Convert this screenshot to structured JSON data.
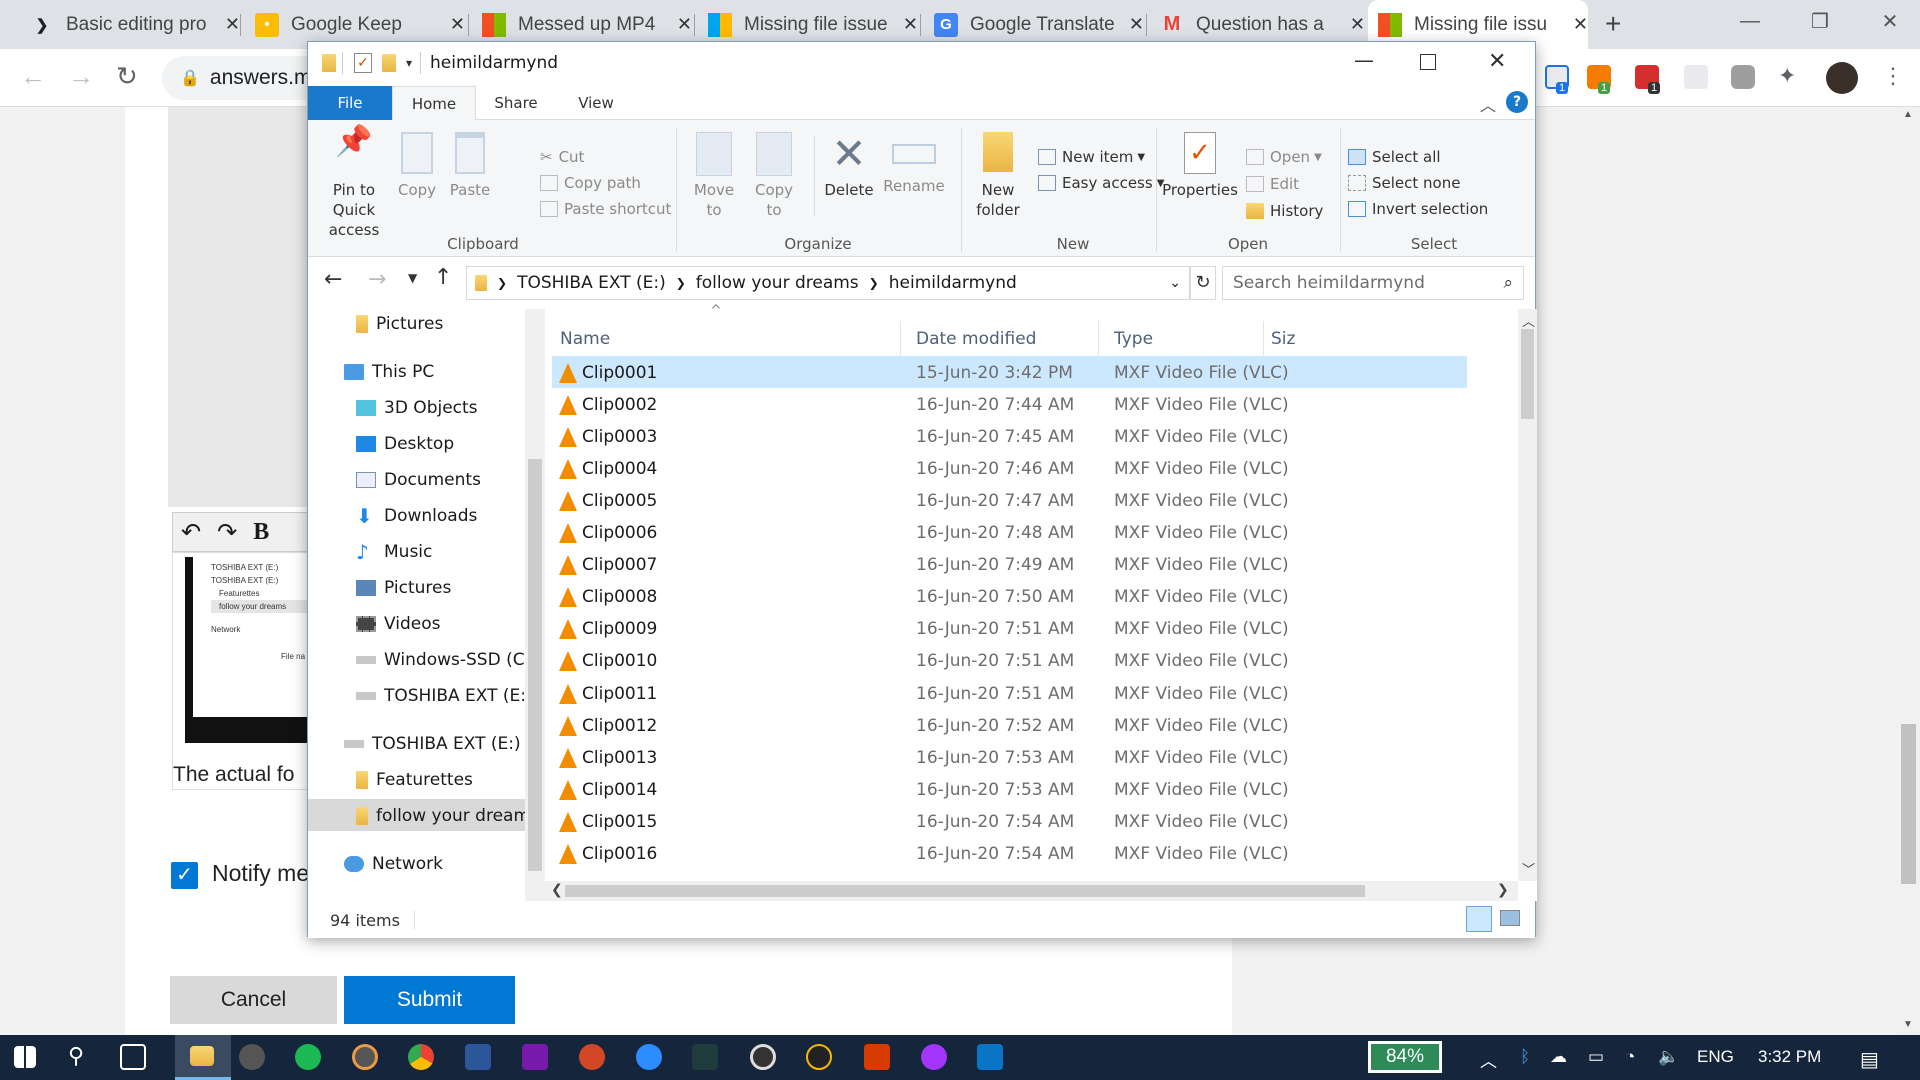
{
  "browser": {
    "tabs": [
      {
        "title": "Basic editing pro",
        "icon": "bookmark-chevron-icon"
      },
      {
        "title": "Google Keep",
        "icon": "keep-icon"
      },
      {
        "title": "Messed up MP4",
        "icon": "microsoft-icon"
      },
      {
        "title": "Missing file issue",
        "icon": "microsoft-icon"
      },
      {
        "title": "Google Translate",
        "icon": "translate-icon"
      },
      {
        "title": "Question has a",
        "icon": "gmail-icon"
      },
      {
        "title": "Missing file issu",
        "icon": "microsoft-icon"
      }
    ],
    "url": "answers.m",
    "extension_badges": [
      "1",
      "1",
      "1"
    ]
  },
  "explorer": {
    "title": "heimildarmynd",
    "ribbon_tabs": [
      "File",
      "Home",
      "Share",
      "View"
    ],
    "clipboard": {
      "pin": "Pin to Quick access",
      "copy": "Copy",
      "paste": "Paste",
      "cut": "Cut",
      "copy_path": "Copy path",
      "paste_shortcut": "Paste shortcut",
      "group": "Clipboard"
    },
    "organize": {
      "move_to": "Move to",
      "copy_to": "Copy to",
      "delete": "Delete",
      "rename": "Rename",
      "group": "Organize"
    },
    "new": {
      "new_folder": "New folder",
      "new_item": "New item",
      "easy_access": "Easy access",
      "group": "New"
    },
    "open": {
      "properties": "Properties",
      "open": "Open",
      "edit": "Edit",
      "history": "History",
      "group": "Open"
    },
    "select": {
      "select_all": "Select all",
      "select_none": "Select none",
      "invert": "Invert selection",
      "group": "Select"
    },
    "breadcrumb": [
      "TOSHIBA EXT (E:)",
      "follow your dreams",
      "heimildarmynd"
    ],
    "search_placeholder": "Search heimildarmynd",
    "nav": [
      {
        "label": "Pictures",
        "icon": "folder-icon"
      },
      {
        "label": "This PC",
        "icon": "computer-icon"
      },
      {
        "label": "3D Objects",
        "icon": "cube-icon"
      },
      {
        "label": "Desktop",
        "icon": "desktop-icon"
      },
      {
        "label": "Documents",
        "icon": "document-icon"
      },
      {
        "label": "Downloads",
        "icon": "download-icon"
      },
      {
        "label": "Music",
        "icon": "music-icon"
      },
      {
        "label": "Pictures",
        "icon": "pictures-icon"
      },
      {
        "label": "Videos",
        "icon": "videos-icon"
      },
      {
        "label": "Windows-SSD (C:)",
        "icon": "drive-icon"
      },
      {
        "label": "TOSHIBA EXT (E:)",
        "icon": "drive-icon"
      },
      {
        "label": "TOSHIBA EXT (E:)",
        "icon": "drive-icon"
      },
      {
        "label": "Featurettes",
        "icon": "folder-icon"
      },
      {
        "label": "follow your dreams",
        "icon": "folder-icon"
      },
      {
        "label": "Network",
        "icon": "network-icon"
      }
    ],
    "columns": [
      "Name",
      "Date modified",
      "Type",
      "Siz"
    ],
    "files": [
      {
        "name": "Clip0001",
        "date": "15-Jun-20 3:42 PM",
        "type": "MXF Video File (VLC)"
      },
      {
        "name": "Clip0002",
        "date": "16-Jun-20 7:44 AM",
        "type": "MXF Video File (VLC)"
      },
      {
        "name": "Clip0003",
        "date": "16-Jun-20 7:45 AM",
        "type": "MXF Video File (VLC)"
      },
      {
        "name": "Clip0004",
        "date": "16-Jun-20 7:46 AM",
        "type": "MXF Video File (VLC)"
      },
      {
        "name": "Clip0005",
        "date": "16-Jun-20 7:47 AM",
        "type": "MXF Video File (VLC)"
      },
      {
        "name": "Clip0006",
        "date": "16-Jun-20 7:48 AM",
        "type": "MXF Video File (VLC)"
      },
      {
        "name": "Clip0007",
        "date": "16-Jun-20 7:49 AM",
        "type": "MXF Video File (VLC)"
      },
      {
        "name": "Clip0008",
        "date": "16-Jun-20 7:50 AM",
        "type": "MXF Video File (VLC)"
      },
      {
        "name": "Clip0009",
        "date": "16-Jun-20 7:51 AM",
        "type": "MXF Video File (VLC)"
      },
      {
        "name": "Clip0010",
        "date": "16-Jun-20 7:51 AM",
        "type": "MXF Video File (VLC)"
      },
      {
        "name": "Clip0011",
        "date": "16-Jun-20 7:51 AM",
        "type": "MXF Video File (VLC)"
      },
      {
        "name": "Clip0012",
        "date": "16-Jun-20 7:52 AM",
        "type": "MXF Video File (VLC)"
      },
      {
        "name": "Clip0013",
        "date": "16-Jun-20 7:53 AM",
        "type": "MXF Video File (VLC)"
      },
      {
        "name": "Clip0014",
        "date": "16-Jun-20 7:53 AM",
        "type": "MXF Video File (VLC)"
      },
      {
        "name": "Clip0015",
        "date": "16-Jun-20 7:54 AM",
        "type": "MXF Video File (VLC)"
      },
      {
        "name": "Clip0016",
        "date": "16-Jun-20 7:54 AM",
        "type": "MXF Video File (VLC)"
      }
    ],
    "item_count": "94 items"
  },
  "page": {
    "thumb_lines": [
      "TOSHIBA EXT (E:)",
      "TOSHIBA EXT (E:)",
      "Featurettes",
      "follow your dreams",
      "Network",
      "File na"
    ],
    "caption": "The actual fo",
    "notify": "Notify me",
    "cancel": "Cancel",
    "submit": "Submit"
  },
  "taskbar": {
    "battery": "84%",
    "language": "ENG",
    "time": "3:32 PM"
  },
  "colors": {
    "accent": "#1a73e8",
    "explorer_file_tab": "#1979ca",
    "submit": "#0078d4",
    "selection": "#cce8ff",
    "taskbar": "#14253c"
  }
}
